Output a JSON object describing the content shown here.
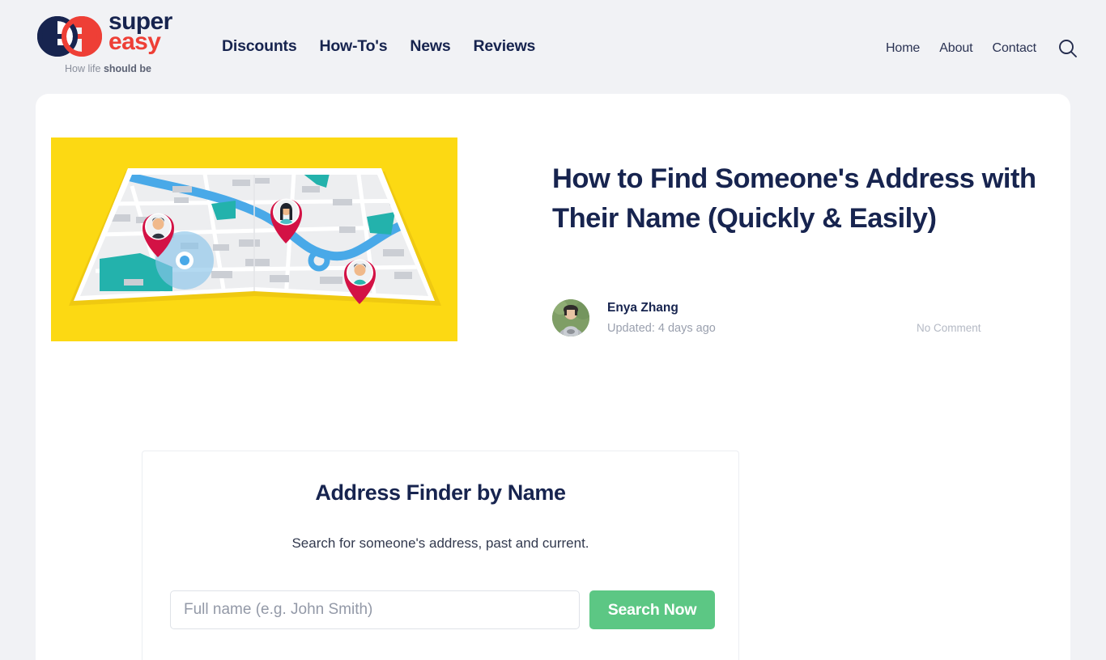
{
  "brand": {
    "name_line1": "super",
    "name_line2": "easy",
    "tagline_prefix": "How life ",
    "tagline_bold": "should be",
    "logo_icon": "superreasy-double-e-logo",
    "navy": "#17244f",
    "red": "#ee3f36"
  },
  "nav": {
    "main_items": [
      {
        "label": "Discounts"
      },
      {
        "label": "How-To's"
      },
      {
        "label": "News"
      },
      {
        "label": "Reviews"
      }
    ],
    "right_items": [
      {
        "label": "Home"
      },
      {
        "label": "About"
      },
      {
        "label": "Contact"
      }
    ],
    "search_icon": "search-icon"
  },
  "article": {
    "title": "How to Find Someone's Address with Their Name (Quickly & Easily)",
    "hero_image_alt": "folded-city-map-with-person-location-pins",
    "hero_bg": "#fcd913",
    "author": {
      "name": "Enya Zhang",
      "updated": "Updated: 4 days ago",
      "avatar_alt": "author-portrait"
    },
    "comments": "No Comment"
  },
  "widget": {
    "title": "Address Finder by Name",
    "subtitle": "Search for someone's address, past and current.",
    "input_placeholder": "Full name (e.g. John Smith)",
    "input_value": "",
    "submit_label": "Search Now",
    "submit_color": "#5cc784"
  }
}
